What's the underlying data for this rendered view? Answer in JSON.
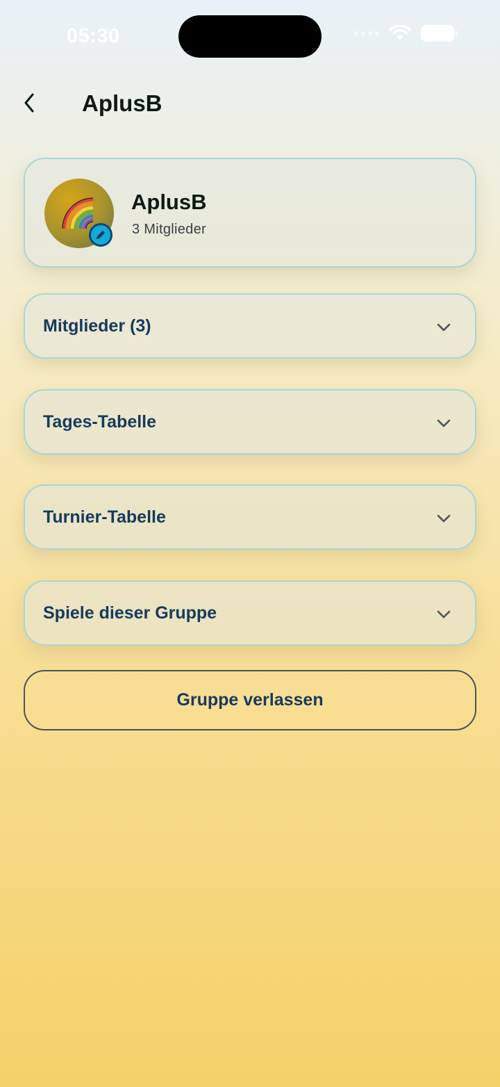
{
  "status_bar": {
    "time": "05:30"
  },
  "header": {
    "title": "AplusB"
  },
  "group": {
    "name": "AplusB",
    "member_count": "3 Mitglieder"
  },
  "sections": [
    {
      "label": "Mitglieder (3)"
    },
    {
      "label": "Tages-Tabelle"
    },
    {
      "label": "Turnier-Tabelle"
    },
    {
      "label": "Spiele dieser Gruppe"
    }
  ],
  "leave_button": {
    "label": "Gruppe verlassen"
  },
  "colors": {
    "accent_text": "#163a5c",
    "card_border": "#a9d5d6",
    "edit_badge": "#16a8d8"
  }
}
